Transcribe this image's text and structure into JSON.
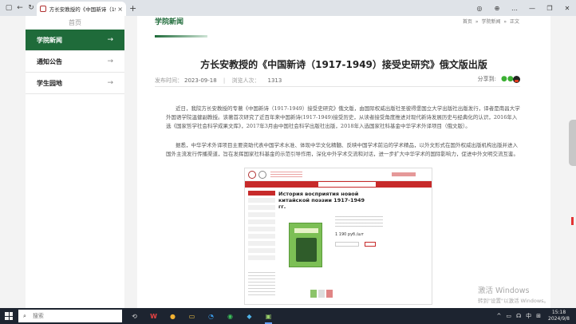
{
  "browser": {
    "tab_title": "方长安教授的《中国新诗（19",
    "tab_close": "×",
    "new_tab": "+",
    "back": "←",
    "refresh": "↻",
    "controls": [
      "◎",
      "⊕",
      "…",
      "—",
      "❐",
      "✕"
    ]
  },
  "sidebar": {
    "top_label": "首页",
    "items": [
      {
        "label": "学院新闻",
        "active": true,
        "arrow": "→"
      },
      {
        "label": "通知公告",
        "active": false,
        "arrow": "→"
      },
      {
        "label": "学生园地",
        "active": false,
        "arrow": "→"
      }
    ]
  },
  "section": {
    "title": "学院新闻",
    "breadcrumb": [
      "首页",
      "»",
      "学院新闻",
      "»",
      "正文"
    ]
  },
  "article": {
    "title": "方长安教授的《中国新诗（1917-1949）接受史研究》俄文版出版",
    "date_label": "发布时间：",
    "date": "2023-09-18",
    "views_label": "浏览人次：",
    "views": "1313",
    "share_label": "分享到:",
    "paragraph1": "近日，我院方长安教授的专著《中国新诗（1917-1949）接受史研究》俄文版，由国际权威出版社圣彼得堡国立大学出版社出版发行，译者是南昌大学外国语学院温健副教授。该著首次研究了近百年来中国新诗(1917-1949)接受历史，从读者接受角度推进对现代新诗发展历史与经典化的认识，2016年入选《国家哲学社会科学成果文库》，2017年3月由中国社会科学出版社出版，2018年入选国家社科基金中华学术外译项目（俄文版）。",
    "paragraph2": "据悉，中华学术外译项目主要资助代表中国学术水准、体现中华文化精髓、反映中国学术前沿的学术精品，以外文形式在国外权威出版机构出版并进入国外主流发行传播渠道，旨在发挥国家社科基金的示范引导作用，深化中外学术交流和对话，进一步扩大中华学术的国际影响力，促进中外文明交流互鉴。",
    "image_book_title": "История восприятия новой китайской поэзии 1917-1949 гг.",
    "image_price": "1 190 руб./шт"
  },
  "watermark": {
    "line1": "激活 Windows",
    "line2": "转到\"设置\"以激活 Windows。"
  },
  "taskbar": {
    "search_placeholder": "搜索",
    "search_icon": "⌕",
    "apps": [
      "⟲",
      "W",
      "●",
      "▭",
      "◔",
      "◉",
      "◆",
      "▣"
    ],
    "tray_icons": [
      "^",
      "▭",
      "☊",
      "中",
      "⊞"
    ],
    "time": "15:18",
    "date": "2024/9/8"
  }
}
